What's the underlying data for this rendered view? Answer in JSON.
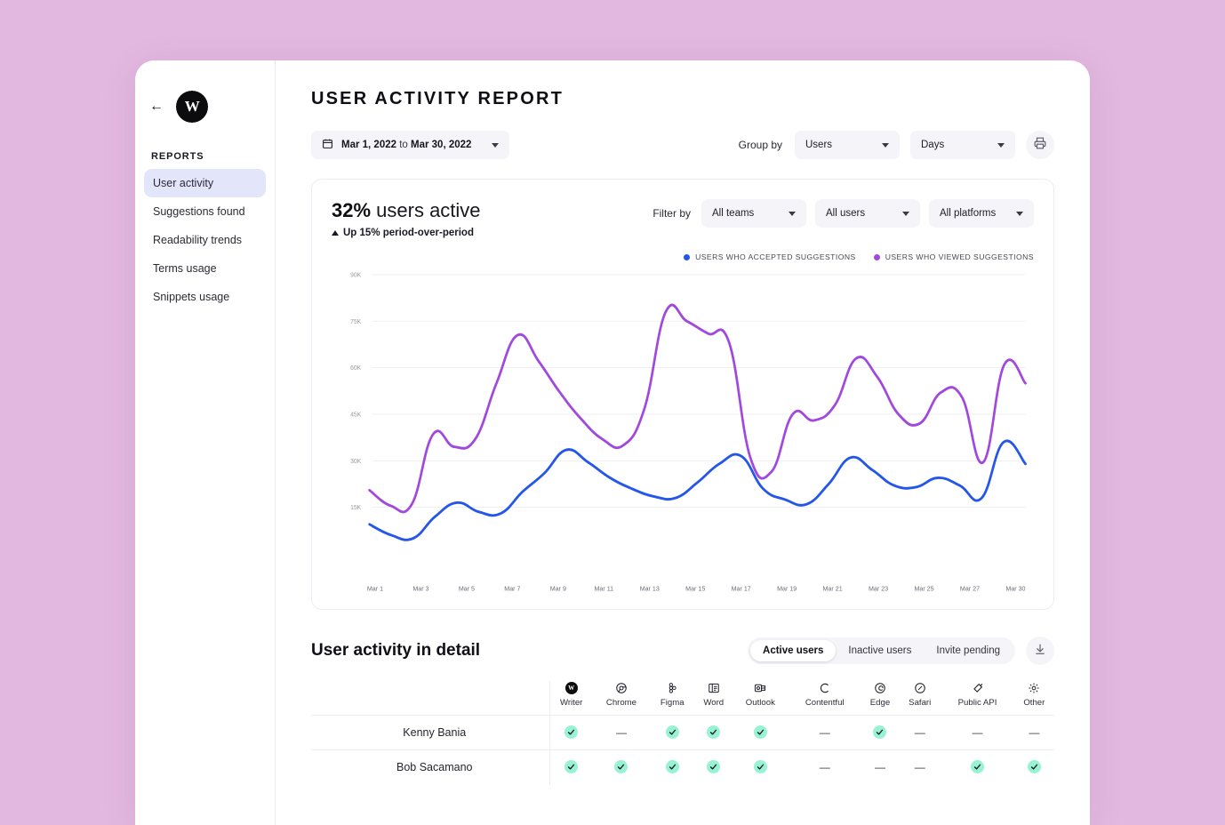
{
  "sidebar": {
    "back_icon": "arrow-left-icon",
    "logo_text": "W",
    "heading": "REPORTS",
    "items": [
      {
        "label": "User activity",
        "active": true
      },
      {
        "label": "Suggestions found",
        "active": false
      },
      {
        "label": "Readability trends",
        "active": false
      },
      {
        "label": "Terms usage",
        "active": false
      },
      {
        "label": "Snippets usage",
        "active": false
      }
    ]
  },
  "header": {
    "title": "USER ACTIVITY REPORT"
  },
  "toolbar": {
    "calendar_icon": "calendar-icon",
    "date_from": "Mar 1, 2022",
    "date_sep": "to",
    "date_to": "Mar 30, 2022",
    "group_by_label": "Group by",
    "group_by_value": "Users",
    "interval_value": "Days",
    "print_icon": "printer-icon"
  },
  "chart_card": {
    "kpi_number": "32%",
    "kpi_text": " users active",
    "kpi_sub": "Up 15% period-over-period",
    "filter_label": "Filter by",
    "filters": [
      "All teams",
      "All users",
      "All platforms"
    ]
  },
  "chart_data": {
    "type": "line",
    "title": "",
    "xlabel": "",
    "ylabel": "",
    "ylim": [
      0,
      90000
    ],
    "grid": true,
    "legend_position": "top-right",
    "ytick_labels": [
      "15K",
      "30K",
      "45K",
      "60K",
      "75K",
      "90K"
    ],
    "yticks": [
      15000,
      30000,
      45000,
      60000,
      75000,
      90000
    ],
    "xtick_labels": [
      "Mar 1",
      "Mar 3",
      "Mar 5",
      "Mar 7",
      "Mar 9",
      "Mar 11",
      "Mar 13",
      "Mar 15",
      "Mar 17",
      "Mar 19",
      "Mar 21",
      "Mar 23",
      "Mar 25",
      "Mar 27",
      "Mar 30"
    ],
    "x": [
      1,
      2,
      3,
      4,
      5,
      6,
      7,
      8,
      9,
      10,
      11,
      12,
      13,
      14,
      15,
      16,
      17,
      18,
      19,
      20,
      21,
      22,
      23,
      24,
      25,
      26,
      27,
      28,
      29,
      30
    ],
    "series": [
      {
        "name": "USERS WHO ACCEPTED SUGGESTIONS",
        "color": "#2456ea",
        "values": [
          9500,
          6000,
          5000,
          12000,
          16500,
          13500,
          13000,
          20000,
          26000,
          33500,
          29500,
          24500,
          21000,
          18500,
          18000,
          23000,
          29000,
          31500,
          21000,
          17500,
          16000,
          22500,
          31000,
          27000,
          22000,
          21500,
          24500,
          22000,
          18000,
          36000,
          29000
        ]
      },
      {
        "name": "USERS WHO VIEWED SUGGESTIONS",
        "color": "#a148dd",
        "values": [
          20500,
          15500,
          16000,
          38500,
          34500,
          37000,
          55000,
          70500,
          62000,
          52000,
          43500,
          37000,
          35000,
          47000,
          78000,
          75000,
          71000,
          68000,
          31000,
          26500,
          45000,
          43000,
          48000,
          63000,
          57000,
          45000,
          42000,
          52000,
          50500,
          29500,
          61000,
          55000
        ]
      }
    ]
  },
  "detail": {
    "title": "User activity in detail",
    "tabs": [
      {
        "label": "Active users",
        "active": true
      },
      {
        "label": "Inactive users",
        "active": false
      },
      {
        "label": "Invite pending",
        "active": false
      }
    ],
    "download_icon": "download-icon",
    "columns": [
      {
        "name": "Writer",
        "icon": "writer-icon"
      },
      {
        "name": "Chrome",
        "icon": "chrome-icon"
      },
      {
        "name": "Figma",
        "icon": "figma-icon"
      },
      {
        "name": "Word",
        "icon": "word-icon"
      },
      {
        "name": "Outlook",
        "icon": "outlook-icon"
      },
      {
        "name": "Contentful",
        "icon": "contentful-icon"
      },
      {
        "name": "Edge",
        "icon": "edge-icon"
      },
      {
        "name": "Safari",
        "icon": "safari-icon"
      },
      {
        "name": "Public API",
        "icon": "public-api-icon"
      },
      {
        "name": "Other",
        "icon": "gear-icon"
      }
    ],
    "rows": [
      {
        "name": "Kenny Bania",
        "cells": [
          true,
          false,
          true,
          true,
          true,
          false,
          true,
          false,
          false,
          false
        ]
      },
      {
        "name": "Bob Sacamano",
        "cells": [
          true,
          true,
          true,
          true,
          true,
          false,
          false,
          false,
          true,
          true
        ]
      }
    ],
    "dash": "—"
  },
  "colors": {
    "page_background": "#e3b8e0",
    "accent_blue": "#2456ea",
    "accent_purple": "#a148dd",
    "check_green": "#98f2d4",
    "active_nav": "#e3e5fb"
  }
}
